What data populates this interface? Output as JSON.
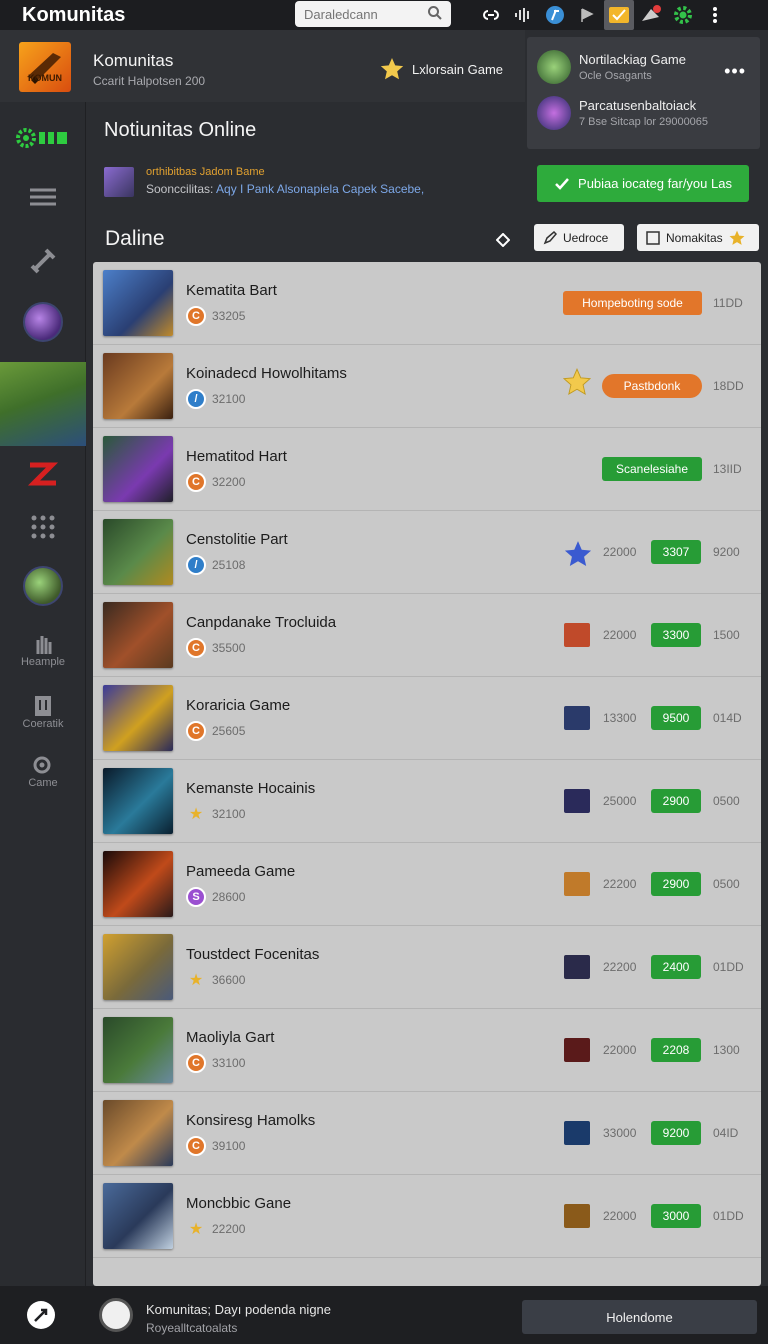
{
  "app": {
    "title": "Komunitas"
  },
  "search": {
    "placeholder": "Daraledcann"
  },
  "header": {
    "title": "Komunitas",
    "subtitle": "Ccarit Halpotsen 200",
    "game_label": "Lxlorsain Game"
  },
  "content": {
    "title": "Notiunitas Online",
    "section_title": "Daline"
  },
  "promo": {
    "line1": "orthibitbas Jadom Bame",
    "line2_prefix": "Soonccilitas:",
    "line2_link": "Aqy I Pank Alsonapiela Capek Sacebe,"
  },
  "rail": {
    "label_a": "Heample",
    "label_b": "Coeratik",
    "label_c": "Came"
  },
  "right_panel": {
    "item1_title": "Nortilackiag Game",
    "item1_sub": "Ocle Osagants",
    "item2_title": "Parcatusenbaltoiack",
    "item2_sub": "7 Bse Sitcap lor 29000065",
    "action_button": "Pubiaa iocateg far/you Las",
    "filter_a": "Uedroce",
    "filter_b": "Nomakitas"
  },
  "rows": [
    {
      "name": "Kematita Bart",
      "meta": "33205",
      "badge": "Hompeboting sode",
      "num_b": "11DD",
      "coin_color": "#e0762a",
      "coin_glyph": "C"
    },
    {
      "name": "Koinadecd Howolhitams",
      "meta": "32100",
      "badge": "Pastbdonk",
      "num_b": "18DD",
      "coin_color": "#2f7ec9",
      "coin_glyph": "/"
    },
    {
      "name": "Hematitod Hart",
      "meta": "32200",
      "badge": "Scanelesiahe",
      "num_b": "13IID",
      "coin_color": "#e0762a",
      "coin_glyph": "C"
    },
    {
      "name": "Censtolitie Part",
      "meta": "25108",
      "num_a": "22000",
      "badge": "3307",
      "num_b": "9200",
      "coin_color": "#2f7ec9",
      "coin_glyph": "/"
    },
    {
      "name": "Canpdanake Trocluida",
      "meta": "35500",
      "num_a": "22000",
      "badge": "3300",
      "num_b": "1500",
      "coin_color": "#e0762a",
      "coin_glyph": "C"
    },
    {
      "name": "Koraricia Game",
      "meta": "25605",
      "num_a": "13300",
      "badge": "9500",
      "num_b": "014D",
      "coin_color": "#e0762a",
      "coin_glyph": "C"
    },
    {
      "name": "Kemanste Hocainis",
      "meta": "32100",
      "num_a": "25000",
      "badge": "2900",
      "num_b": "0500",
      "coin_color": "star",
      "coin_glyph": "★"
    },
    {
      "name": "Pameeda Game",
      "meta": "28600",
      "num_a": "22200",
      "badge": "2900",
      "num_b": "0500",
      "coin_color": "#9a4fd0",
      "coin_glyph": "S"
    },
    {
      "name": "Toustdect Focenitas",
      "meta": "36600",
      "num_a": "22200",
      "badge": "2400",
      "num_b": "01DD",
      "coin_color": "star",
      "coin_glyph": "★"
    },
    {
      "name": "Maoliyla Gart",
      "meta": "33100",
      "num_a": "22000",
      "badge": "2208",
      "num_b": "1300",
      "coin_color": "#e0762a",
      "coin_glyph": "C"
    },
    {
      "name": "Konsiresg Hamolks",
      "meta": "39100",
      "num_a": "33000",
      "badge": "9200",
      "num_b": "04ID",
      "coin_color": "#e0762a",
      "coin_glyph": "C"
    },
    {
      "name": "Moncbbic Gane",
      "meta": "22200",
      "num_a": "22000",
      "badge": "3000",
      "num_b": "01DD",
      "coin_color": "star",
      "coin_glyph": "★"
    }
  ],
  "bottom": {
    "line1": "Komunitas; Dayı podenda nigne",
    "line2": "Royealltcatoalats",
    "button": "Holendome"
  }
}
